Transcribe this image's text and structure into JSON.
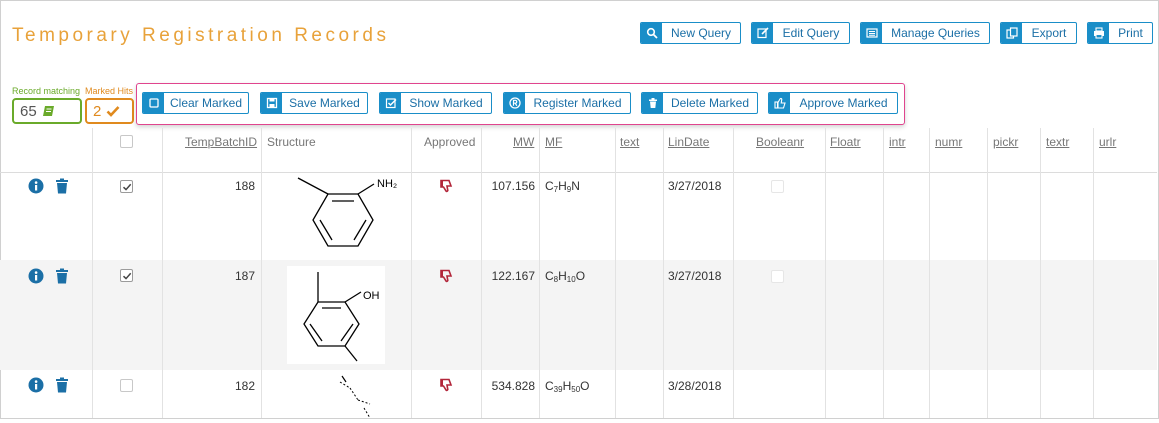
{
  "page": {
    "title": "Temporary Registration Records"
  },
  "toolbar": {
    "new_query": "New Query",
    "edit_query": "Edit Query",
    "manage_queries": "Manage Queries",
    "export": "Export",
    "print": "Print"
  },
  "stats": {
    "record_matching_label": "Record matching",
    "record_matching_count": "65",
    "marked_hits_label": "Marked Hits",
    "marked_hits_count": "2"
  },
  "marked_actions": {
    "clear": "Clear Marked",
    "save": "Save Marked",
    "show": "Show Marked",
    "register": "Register Marked",
    "delete": "Delete Marked",
    "approve": "Approve Marked"
  },
  "columns": {
    "temp_batch_id": "TempBatchID",
    "structure": "Structure",
    "approved": "Approved",
    "mw": "MW",
    "mf": "MF",
    "text": "text",
    "lin_date": "LinDate",
    "booleanr": "Booleanr",
    "floatr": "Floatr",
    "intr": "intr",
    "numr": "numr",
    "pickr": "pickr",
    "textr": "textr",
    "urlr": "urlr"
  },
  "rows": [
    {
      "id": "188",
      "mw": "107.156",
      "mf": {
        "p1": "C",
        "s1": "7",
        "p2": "H",
        "s2": "9",
        "p3": "N"
      },
      "date": "3/27/2018",
      "checked": true,
      "nh2_label": "NH₂"
    },
    {
      "id": "187",
      "mw": "122.167",
      "mf": {
        "p1": "C",
        "s1": "8",
        "p2": "H",
        "s2": "10",
        "p3": "O"
      },
      "date": "3/27/2018",
      "checked": true,
      "oh_label": "OH"
    },
    {
      "id": "182",
      "mw": "534.828",
      "mf": {
        "p1": "C",
        "s1": "39",
        "p2": "H",
        "s2": "50",
        "p3": "O"
      },
      "date": "3/28/2018",
      "checked": false
    }
  ],
  "colors": {
    "accent": "#1a8ec8",
    "title": "#e8a23a",
    "record_green": "#6aaa2a",
    "marked_orange": "#e08a1e",
    "highlight_pink": "#e0448e",
    "thumbs_down_red": "#b2263a"
  },
  "icons": {
    "new_query": "search-icon",
    "edit_query": "edit-icon",
    "manage_queries": "list-icon",
    "export": "copy-icon",
    "print": "print-icon",
    "clear": "square-icon",
    "save": "save-icon",
    "show": "checkbox-icon",
    "register": "registered-icon",
    "delete": "trash-icon",
    "approve": "thumbs-up-icon"
  }
}
